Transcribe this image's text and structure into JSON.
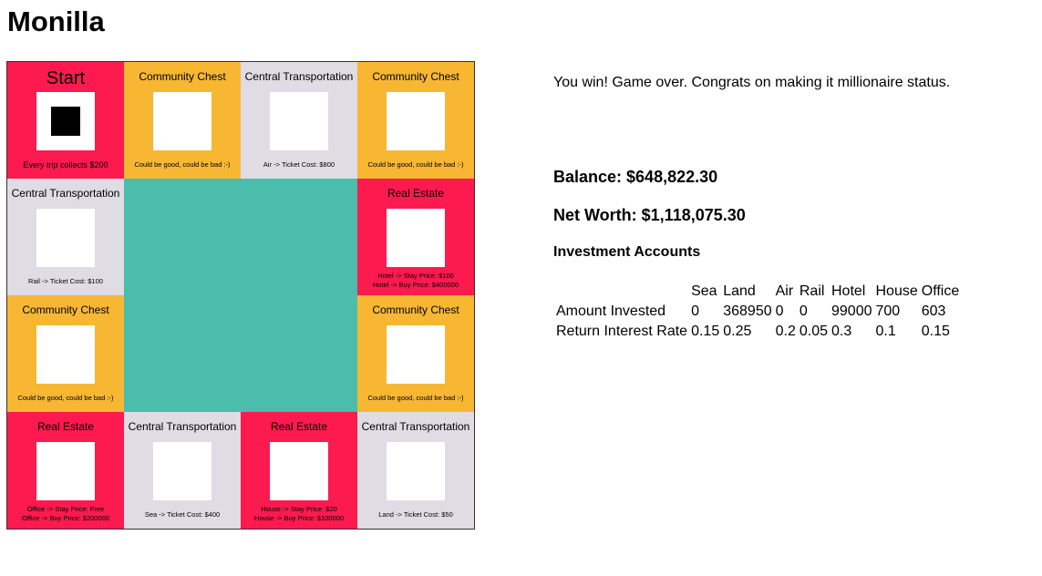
{
  "app": {
    "title": "Monilla"
  },
  "board": {
    "tiles": [
      {
        "label": "Start",
        "info": "Every trip collects $200"
      },
      {
        "label": "Community Chest",
        "info": "Could be good, could be bad :-)"
      },
      {
        "label": "Central Transportation",
        "info": "Air -> Ticket Cost: $800"
      },
      {
        "label": "Community Chest",
        "info": "Could be good, could be bad :-)"
      },
      {
        "label": "Central Transportation",
        "info": "Rail -> Ticket Cost: $100"
      },
      {
        "label": "Real Estate",
        "info": "Hotel -> Stay Price: $100\nHotel -> Buy Price: $400000"
      },
      {
        "label": "Community Chest",
        "info": "Could be good, could be bad :-)"
      },
      {
        "label": "Community Chest",
        "info": "Could be good, could be bad :-)"
      },
      {
        "label": "Real Estate",
        "info": "Office -> Stay Price: Free\nOffice -> Buy Price: $200000"
      },
      {
        "label": "Central Transportation",
        "info": "Sea -> Ticket Cost: $400"
      },
      {
        "label": "Real Estate",
        "info": "House -> Stay Price: $20\nHouse -> Buy Price: $100000"
      },
      {
        "label": "Central Transportation",
        "info": "Land -> Ticket Cost: $50"
      }
    ],
    "colors": {
      "red": "#fc1a4f",
      "orange": "#f7b733",
      "gray": "#dfdce3",
      "center": "#4abdac"
    }
  },
  "status": {
    "message": "You win! Game over. Congrats on making it millionaire status.",
    "balance": "Balance: $648,822.30",
    "net_worth": "Net Worth: $1,118,075.30"
  },
  "investments": {
    "title": "Investment Accounts",
    "headers": [
      "",
      "Sea",
      "Land",
      "Air",
      "Rail",
      "Hotel",
      "House",
      "Office"
    ],
    "rows": [
      [
        "Amount Invested",
        "0",
        "368950",
        "0",
        "0",
        "99000",
        "700",
        "603"
      ],
      [
        "Return Interest Rate",
        "0.15",
        "0.25",
        "0.2",
        "0.05",
        "0.3",
        "0.1",
        "0.15"
      ]
    ]
  }
}
